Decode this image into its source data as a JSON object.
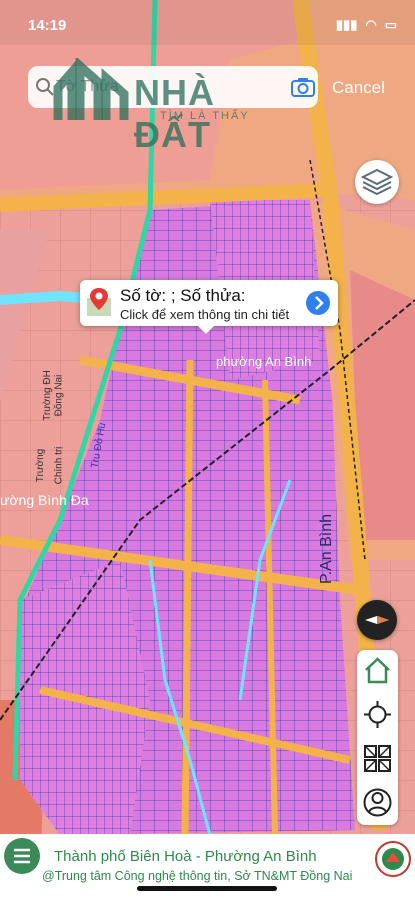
{
  "status_bar": {
    "time": "14:19"
  },
  "search": {
    "placeholder": "Tờ Thửa",
    "cancel_label": "Cancel"
  },
  "watermark": {
    "brand": "NHÀ ĐẤT",
    "sub": "TÌM LÀ THẤY"
  },
  "popup": {
    "title": "Số tờ: ; Số thửa:",
    "subtitle": "Click để xem thông tin chi tiết"
  },
  "map_labels": {
    "ward_an_binh": "phường An Bình",
    "ward_binh_da": "ường Bình Đa",
    "street_pham_an_binh": "P.An Bình",
    "pos_1": "Tru Đỏ Hu",
    "univ_1": "Trường ĐH",
    "univ_2": "Đồng Nai",
    "school_1": "Trường",
    "school_2": "Chính trị"
  },
  "bottom_bar": {
    "title": "Thành phố Biên Hoà - Phường An Bình",
    "credit": "@Trung tâm Công nghệ thông tin, Sở TN&MT Đồng Nai"
  },
  "colors": {
    "residential": "#e27de0",
    "commercial": "#f0a882",
    "road": "#f3b24a",
    "accent": "#2c8a4a"
  }
}
